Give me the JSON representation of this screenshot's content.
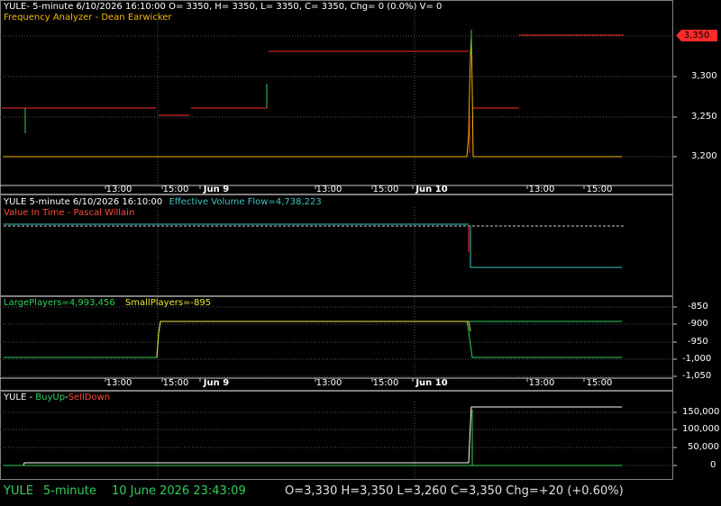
{
  "panel1": {
    "header_line": "YULE- 5-minute 6/10/2026 16:10:00 O= 3350, H= 3350, L= 3350, C= 3350, Chg= 0 (0.0%) V= 0",
    "indicator_label": "Frequency Analyzer - Dean Earwicker",
    "y_ticks": [
      "3,300",
      "3,250",
      "3,200"
    ],
    "last_price_badge": "3,350",
    "x_ticks": [
      "13:00",
      "15:00",
      "Jun 9",
      "13:00",
      "15:00",
      "Jun 10",
      "13:00",
      "15:00"
    ]
  },
  "panel2": {
    "header_symbol": "YULE 5-minute  6/10/2026 16:10:00",
    "header_indicator": "Effective Volume Flow=4,738,223",
    "indicator_label": "Value In Time - Pascal Willain"
  },
  "panel3": {
    "large_players": "LargePlayers=4,993,456",
    "small_players": "SmallPlayers=-895",
    "y_ticks": [
      "-850",
      "-900",
      "-950",
      "-1,000",
      "-1,050"
    ],
    "x_ticks": [
      "13:00",
      "15:00",
      "Jun 9",
      "13:00",
      "15:00",
      "Jun 10",
      "13:00",
      "15:00"
    ]
  },
  "panel4": {
    "symbol": "YULE - ",
    "buy_up": "BuyUp",
    "separator": "-",
    "sell_down": "SellDown",
    "y_ticks": [
      "150,000",
      "100,000",
      "50,000",
      "0"
    ]
  },
  "statusbar": {
    "symbol": "YULE",
    "interval": "5-minute",
    "datetime": "10 June 2026 23:43:09",
    "ohlc": "O=3,330  H=3,350  L=3,260  C=3,350  Chg=+20 (+0.60%)"
  },
  "colors": {
    "grid": "#4a4a4a",
    "price_red": "#ff2a2a",
    "price_green": "#2fd05a",
    "orange": "#f5b800",
    "cyan": "#3ec3c3"
  }
}
